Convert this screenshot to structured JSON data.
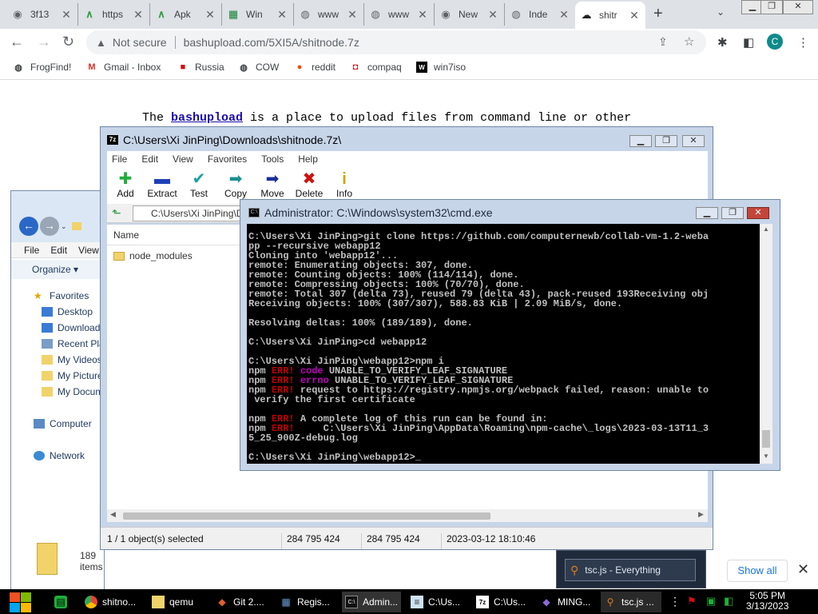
{
  "browser": {
    "tabs": [
      {
        "label": "3f13",
        "icon": "chrome-tab-icon"
      },
      {
        "label": "https",
        "icon": "apkmirror-icon"
      },
      {
        "label": "Apk",
        "icon": "apkmirror-icon"
      },
      {
        "label": "Win",
        "icon": "spreadsheet-icon"
      },
      {
        "label": "www",
        "icon": "globe-icon"
      },
      {
        "label": "www",
        "icon": "globe-icon"
      },
      {
        "label": "New",
        "icon": "chrome-tab-icon"
      },
      {
        "label": "Inde",
        "icon": "globe-icon"
      },
      {
        "label": "shitr",
        "icon": "cloud-upload-icon"
      }
    ],
    "new_tab_label": "+",
    "tab_menu_label": "⌄",
    "address": {
      "security": "Not secure",
      "url": "bashupload.com/5XI5A/shitnode.7z"
    },
    "profile_initial": "C",
    "bookmarks": [
      {
        "label": "FrogFind!"
      },
      {
        "label": "Gmail - Inbox"
      },
      {
        "label": "Russia"
      },
      {
        "label": "COW"
      },
      {
        "label": "reddit"
      },
      {
        "label": "compaq"
      },
      {
        "label": "win7iso"
      }
    ]
  },
  "page": {
    "intro_pre": "The ",
    "intro_link": "bashupload",
    "intro_post": " is a place to upload files from command line or other"
  },
  "explorer": {
    "menu": [
      "File",
      "Edit",
      "View"
    ],
    "organize": "Organize ▾",
    "nav": [
      {
        "label": "Favorites"
      },
      {
        "label": "Desktop"
      },
      {
        "label": "Downloads"
      },
      {
        "label": "Recent Places"
      },
      {
        "label": "My Videos"
      },
      {
        "label": "My Pictures"
      },
      {
        "label": "My Documents"
      },
      {
        "label": "Computer"
      },
      {
        "label": "Network"
      }
    ],
    "item_count": "189 items"
  },
  "zip": {
    "title": "C:\\Users\\Xi JinPing\\Downloads\\shitnode.7z\\",
    "menu": [
      "File",
      "Edit",
      "View",
      "Favorites",
      "Tools",
      "Help"
    ],
    "tools": [
      {
        "label": "Add",
        "glyph": "✚",
        "color": "#1fae3a"
      },
      {
        "label": "Extract",
        "glyph": "▬",
        "color": "#1c3fb8"
      },
      {
        "label": "Test",
        "glyph": "✔",
        "color": "#1aa0a0"
      },
      {
        "label": "Copy",
        "glyph": "➡",
        "color": "#1c8f8f"
      },
      {
        "label": "Move",
        "glyph": "➡",
        "color": "#1c2f9a"
      },
      {
        "label": "Delete",
        "glyph": "✖",
        "color": "#d01010"
      },
      {
        "label": "Info",
        "glyph": "i",
        "color": "#c8a400"
      }
    ],
    "address": "C:\\Users\\Xi JinPing\\D",
    "column_name": "Name",
    "rows": [
      {
        "name": "node_modules"
      }
    ],
    "status": {
      "selected": "1 / 1 object(s) selected",
      "size": "284 795 424",
      "packed": "284 795 424",
      "modified": "2023-03-12 18:10:46"
    }
  },
  "cmd": {
    "title": "Administrator: C:\\Windows\\system32\\cmd.exe",
    "lines": [
      [
        {
          "t": "C:\\Users\\Xi JinPing>git clone https://github.com/computernewb/collab-vm-1.2-weba"
        }
      ],
      [
        {
          "t": "pp --recursive webapp12"
        }
      ],
      [
        {
          "t": "Cloning into 'webapp12'..."
        }
      ],
      [
        {
          "t": "remote: Enumerating objects: 307, done."
        }
      ],
      [
        {
          "t": "remote: Counting objects: 100% (114/114), done."
        }
      ],
      [
        {
          "t": "remote: Compressing objects: 100% (70/70), done."
        }
      ],
      [
        {
          "t": "remote: Total 307 (delta 73), reused 79 (delta 43), pack-reused 193Receiving obj"
        }
      ],
      [
        {
          "t": "Receiving objects: 100% (307/307), 588.83 KiB | 2.09 MiB/s, done."
        }
      ],
      [
        {
          "t": ""
        }
      ],
      [
        {
          "t": "Resolving deltas: 100% (189/189), done."
        }
      ],
      [
        {
          "t": ""
        }
      ],
      [
        {
          "t": "C:\\Users\\Xi JinPing>cd webapp12"
        }
      ],
      [
        {
          "t": ""
        }
      ],
      [
        {
          "t": "C:\\Users\\Xi JinPing\\webapp12>npm i"
        }
      ],
      [
        {
          "t": "npm "
        },
        {
          "t": "ERR!",
          "c": "err"
        },
        {
          "t": " "
        },
        {
          "t": "code",
          "c": "mag"
        },
        {
          "t": " UNABLE_TO_VERIFY_LEAF_SIGNATURE"
        }
      ],
      [
        {
          "t": "npm "
        },
        {
          "t": "ERR!",
          "c": "err"
        },
        {
          "t": " "
        },
        {
          "t": "errno",
          "c": "mag"
        },
        {
          "t": " UNABLE_TO_VERIFY_LEAF_SIGNATURE"
        }
      ],
      [
        {
          "t": "npm "
        },
        {
          "t": "ERR!",
          "c": "err"
        },
        {
          "t": " request to https://registry.npmjs.org/webpack failed, reason: unable to"
        }
      ],
      [
        {
          "t": " verify the first certificate"
        }
      ],
      [
        {
          "t": ""
        }
      ],
      [
        {
          "t": "npm "
        },
        {
          "t": "ERR!",
          "c": "err"
        },
        {
          "t": " A complete log of this run can be found in:"
        }
      ],
      [
        {
          "t": "npm "
        },
        {
          "t": "ERR!",
          "c": "err"
        },
        {
          "t": "     C:\\Users\\Xi JinPing\\AppData\\Roaming\\npm-cache\\_logs\\2023-03-13T11_3"
        }
      ],
      [
        {
          "t": "5_25_900Z-debug.log"
        }
      ],
      [
        {
          "t": ""
        }
      ],
      [
        {
          "t": "C:\\Users\\Xi JinPing\\webapp12>_"
        }
      ]
    ]
  },
  "taskbar": {
    "items": [
      {
        "label": "",
        "icon": "messages-icon"
      },
      {
        "label": "shitno...",
        "icon": "chrome-icon"
      },
      {
        "label": "qemu",
        "icon": "folder-icon"
      },
      {
        "label": "Git 2....",
        "icon": "git-icon"
      },
      {
        "label": "Regis...",
        "icon": "registry-icon"
      },
      {
        "label": "Admin...",
        "icon": "cmd-icon"
      },
      {
        "label": "C:\\Us...",
        "icon": "notepad-icon"
      },
      {
        "label": "C:\\Us...",
        "icon": "sevenzip-icon"
      },
      {
        "label": "MING...",
        "icon": "mingw-icon"
      },
      {
        "label": "tsc.js ...",
        "icon": "everything-icon"
      }
    ],
    "time": "5:05 PM",
    "date": "3/13/2023"
  },
  "everything_popup": {
    "label": "tsc.js - Everything"
  },
  "download_shelf": {
    "show_all": "Show all"
  }
}
